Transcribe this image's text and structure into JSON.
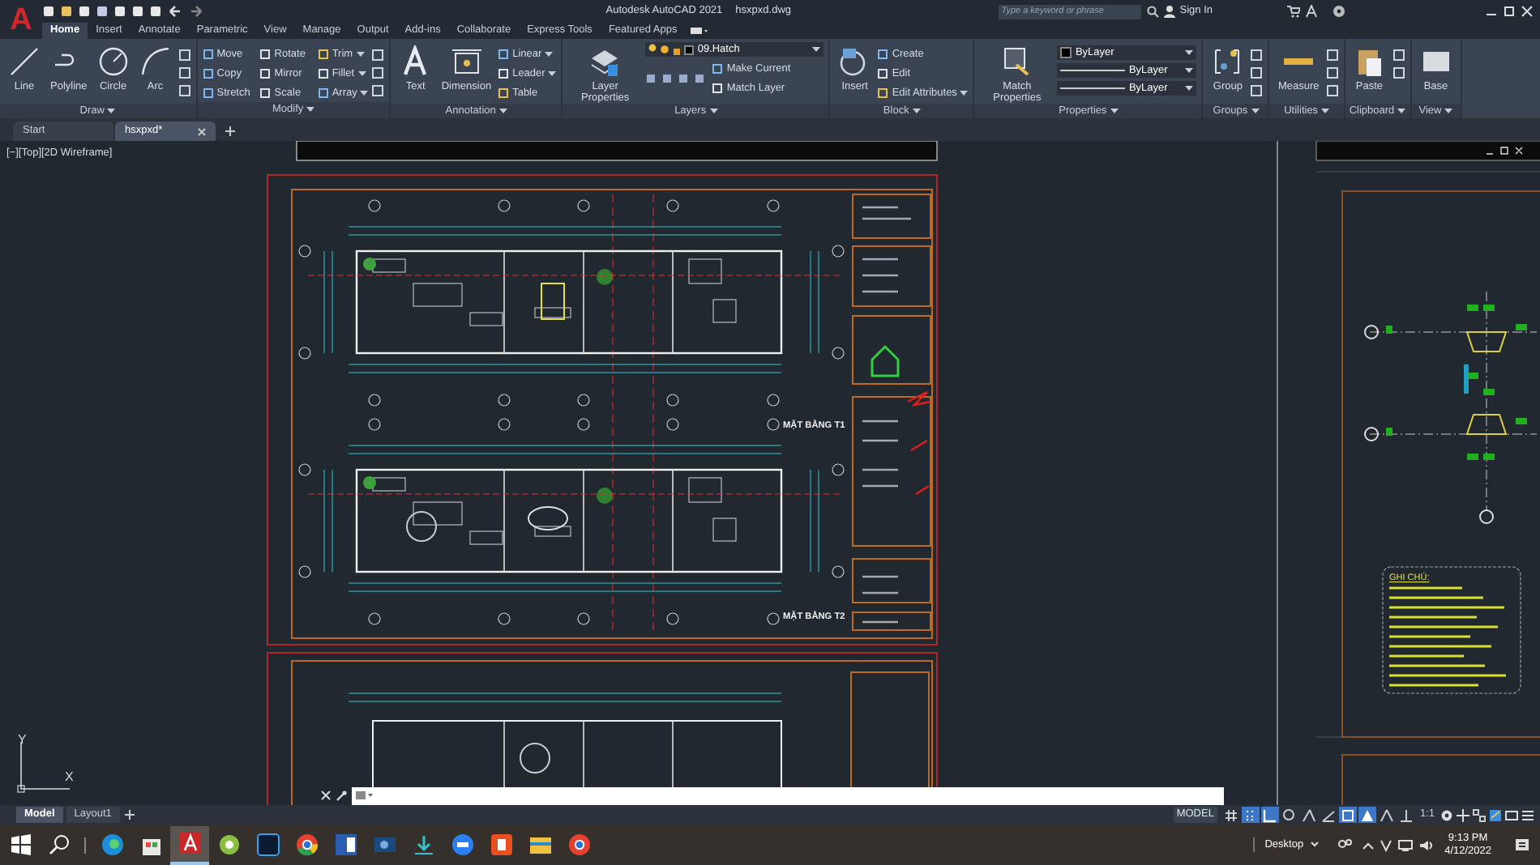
{
  "app_logo": "A",
  "title_bar": {
    "app_title": "Autodesk AutoCAD 2021",
    "file_name": "hsxpxd.dwg",
    "search": {
      "placeholder": "Type a keyword or phrase"
    },
    "sign_in": "Sign In"
  },
  "ribbon_tabs": [
    {
      "label": "Home",
      "selected": true
    },
    {
      "label": "Insert",
      "selected": false
    },
    {
      "label": "Annotate",
      "selected": false
    },
    {
      "label": "Parametric",
      "selected": false
    },
    {
      "label": "View",
      "selected": false
    },
    {
      "label": "Manage",
      "selected": false
    },
    {
      "label": "Output",
      "selected": false
    },
    {
      "label": "Add-ins",
      "selected": false
    },
    {
      "label": "Collaborate",
      "selected": false
    },
    {
      "label": "Express Tools",
      "selected": false
    },
    {
      "label": "Featured Apps",
      "selected": false
    }
  ],
  "ribbon_panels": [
    {
      "kind": "draw",
      "title": "Draw",
      "large": [
        "Line",
        "Polyline",
        "Circle",
        "Arc"
      ]
    },
    {
      "kind": "modify",
      "title": "Modify",
      "small": [
        {
          "label": "Move",
          "dropdown": false
        },
        {
          "label": "Rotate",
          "dropdown": false
        },
        {
          "label": "Trim",
          "dropdown": true
        },
        {
          "label": "Copy",
          "dropdown": false
        },
        {
          "label": "Mirror",
          "dropdown": false
        },
        {
          "label": "Fillet",
          "dropdown": true
        },
        {
          "label": "Stretch",
          "dropdown": false
        },
        {
          "label": "Scale",
          "dropdown": false
        },
        {
          "label": "Array",
          "dropdown": true
        }
      ]
    },
    {
      "kind": "annotation",
      "title": "Annotation",
      "large": [
        "Text",
        "Dimension"
      ],
      "small": [
        {
          "label": "Linear",
          "dropdown": true
        },
        {
          "label": "Leader",
          "dropdown": true
        },
        {
          "label": "Table",
          "dropdown": false
        }
      ]
    },
    {
      "kind": "layers",
      "title": "Layers",
      "large": [
        "Layer Properties"
      ],
      "select": [
        "09.Hatch"
      ],
      "small": [
        {
          "label": "Make Current",
          "dropdown": false
        },
        {
          "label": "Match Layer",
          "dropdown": false
        }
      ]
    },
    {
      "kind": "block",
      "title": "Block",
      "large": [
        "Insert"
      ],
      "small": [
        {
          "label": "Create",
          "dropdown": false
        },
        {
          "label": "Edit",
          "dropdown": false
        },
        {
          "label": "Edit Attributes",
          "dropdown": true
        }
      ]
    },
    {
      "kind": "properties",
      "title": "Properties",
      "large": [
        "Match Properties"
      ],
      "select": [
        "ByLayer",
        "ByLayer",
        "ByLayer"
      ]
    },
    {
      "kind": "groups",
      "title": "Groups",
      "large": [
        "Group"
      ]
    },
    {
      "kind": "utilities",
      "title": "Utilities",
      "large": [
        "Measure"
      ]
    },
    {
      "kind": "clipboard",
      "title": "Clipboard",
      "large": [
        "Paste"
      ]
    },
    {
      "kind": "view",
      "title": "View",
      "large": [
        "Base"
      ]
    }
  ],
  "file_tabs": [
    {
      "label": "Start",
      "selected": false,
      "closable": false
    },
    {
      "label": "hsxpxd*",
      "selected": true,
      "closable": true
    }
  ],
  "viewport_label": "[−][Top][2D Wireframe]",
  "drawing": {
    "plan_titles": [
      "MẶT BẰNG T1",
      "MẶT BẰNG T2"
    ],
    "note_title": "GHI CHÚ:",
    "ucs_labels": [
      "Y",
      "X"
    ]
  },
  "layout_tabs": [
    {
      "label": "Model",
      "selected": true
    },
    {
      "label": "Layout1",
      "selected": false
    }
  ],
  "status_bar": {
    "space": "MODEL",
    "toggles": [
      {
        "on": false
      },
      {
        "on": true
      },
      {
        "on": true
      },
      {
        "on": false
      },
      {
        "on": false
      },
      {
        "on": false
      },
      {
        "on": true
      },
      {
        "on": true
      },
      {
        "on": false
      },
      {
        "on": false
      }
    ],
    "scale": "1:1"
  },
  "taskbar": {
    "apps": [
      {
        "selected": false
      },
      {
        "selected": false
      },
      {
        "selected": true
      },
      {
        "selected": false
      },
      {
        "selected": false
      },
      {
        "selected": false
      },
      {
        "selected": false
      },
      {
        "selected": false
      },
      {
        "selected": false
      },
      {
        "selected": false
      },
      {
        "selected": false
      },
      {
        "selected": false
      },
      {
        "selected": false
      }
    ],
    "desktop_label": "Desktop",
    "time": "9:13 PM",
    "date": "4/12/2022"
  }
}
